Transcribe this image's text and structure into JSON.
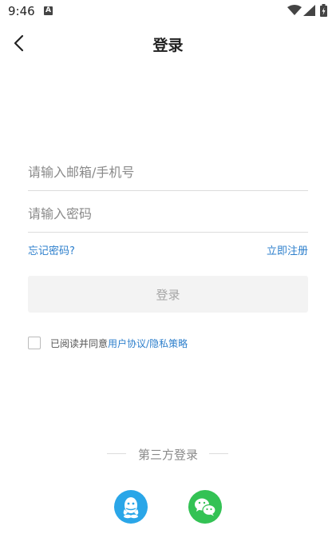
{
  "status_bar": {
    "time": "9:46",
    "notification_letter": "A"
  },
  "header": {
    "title": "登录"
  },
  "form": {
    "email_placeholder": "请输入邮箱/手机号",
    "password_placeholder": "请输入密码",
    "forgot_password": "忘记密码?",
    "register": "立即注册",
    "login_button": "登录"
  },
  "agreement": {
    "prefix": "已阅读并同意",
    "user_agreement": "用户协议",
    "separator": "/",
    "privacy_policy": "隐私策略"
  },
  "third_party": {
    "label": "第三方登录",
    "providers": [
      "qq-icon",
      "wechat-icon"
    ]
  },
  "colors": {
    "link": "#2d7fcc",
    "login_button_bg": "#f3f3f3",
    "qq": "#2aa6e8",
    "wechat": "#33c254"
  }
}
